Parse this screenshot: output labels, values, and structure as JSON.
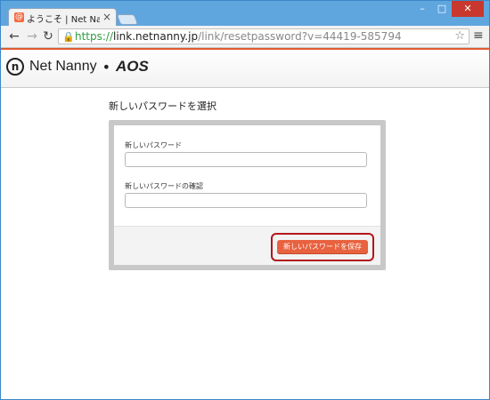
{
  "browser": {
    "tab_title": "ようこそ | Net Nanny イン",
    "favicon_letter": "@",
    "tab_close": "×",
    "controls": {
      "minimize": "–",
      "maximize": "□",
      "close": "✕"
    },
    "nav": {
      "back": "←",
      "forward": "→",
      "reload": "↻"
    },
    "url": {
      "scheme": "https://",
      "host": "link.netnanny.jp",
      "path": "/link/resetpassword?v=44419-585794"
    },
    "star": "☆",
    "menu": "≡"
  },
  "site": {
    "logo_mark": "n",
    "brand": "Net Nanny",
    "separator": "•",
    "partner": "AOS",
    "accent_color": "#e05a2f"
  },
  "form": {
    "heading": "新しいパスワードを選択",
    "new_password_label": "新しいパスワード",
    "confirm_password_label": "新しいパスワードの確認",
    "new_password_value": "",
    "confirm_password_value": "",
    "save_button": "新しいパスワードを保存",
    "button_color": "#e8623f",
    "highlight_color": "#b3161b"
  }
}
